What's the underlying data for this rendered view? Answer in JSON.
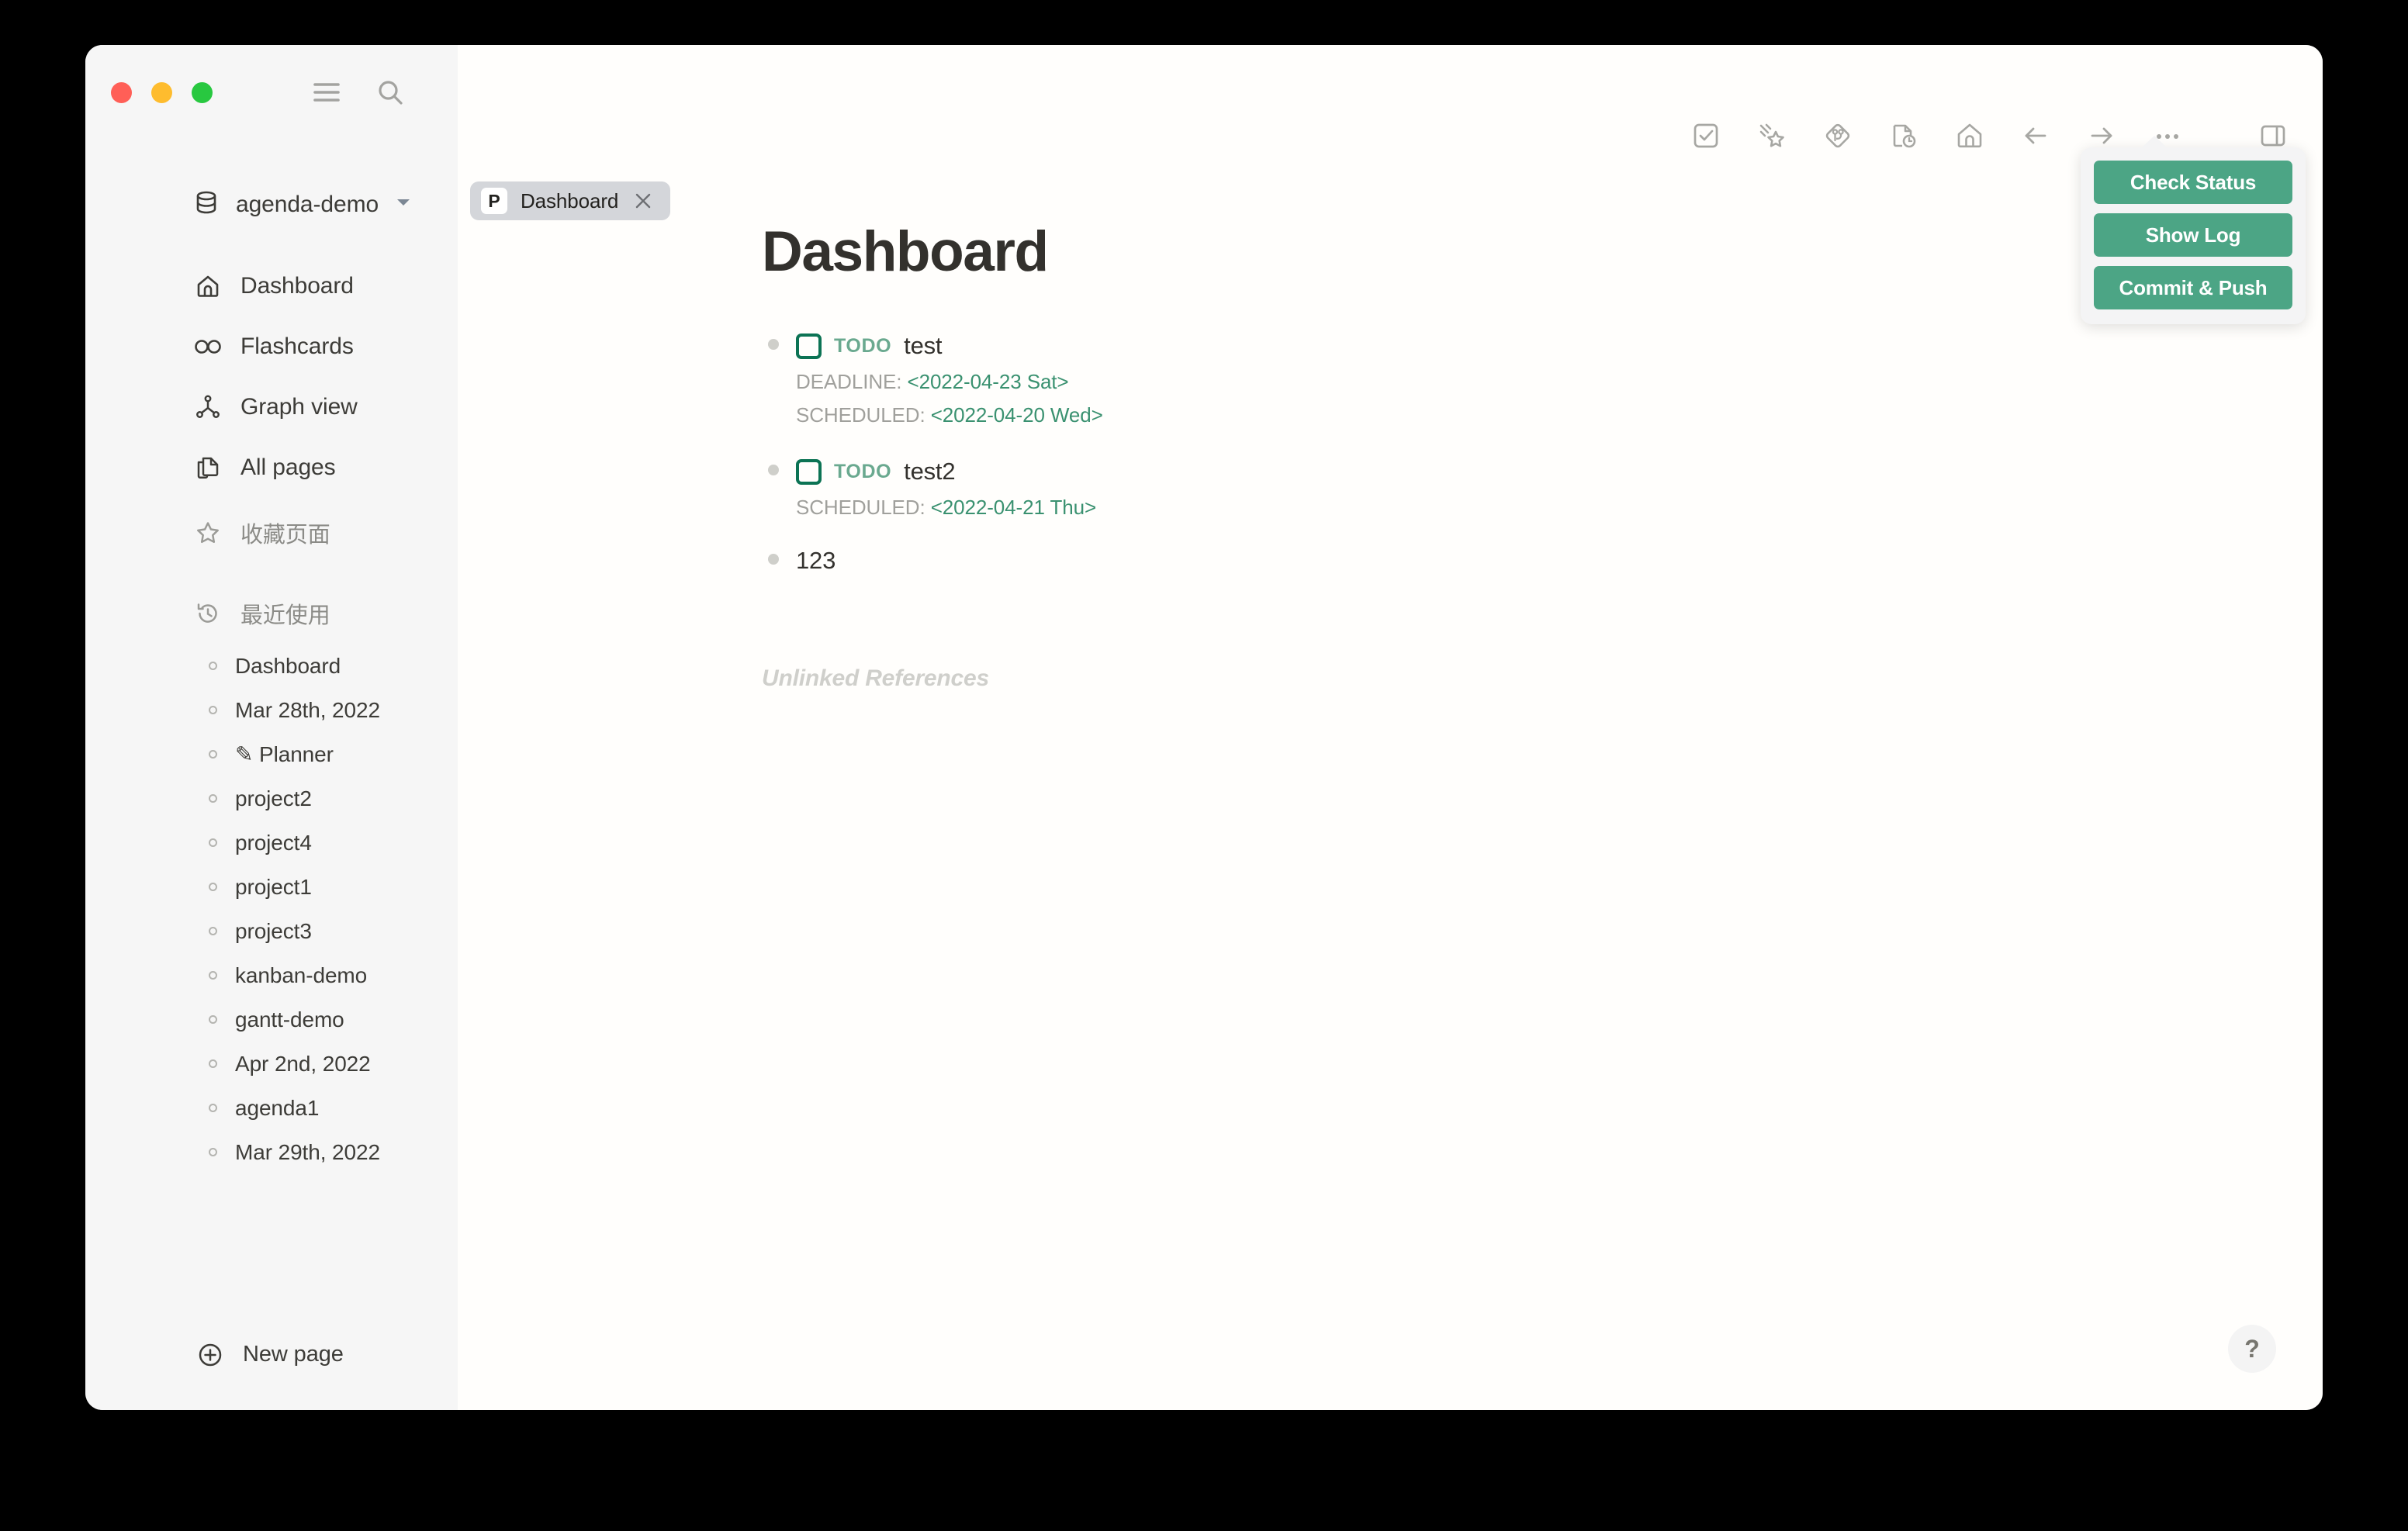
{
  "window": {
    "traffic_lights": [
      "close",
      "minimize",
      "maximize"
    ]
  },
  "sidebar": {
    "menu_icon": "hamburger-menu-icon",
    "search_icon": "search-icon",
    "repo": {
      "icon": "database-icon",
      "name": "agenda-demo",
      "chevron": "chevron-down-icon"
    },
    "nav": [
      {
        "icon": "home-icon",
        "label": "Dashboard"
      },
      {
        "icon": "infinity-icon",
        "label": "Flashcards"
      },
      {
        "icon": "graph-icon",
        "label": "Graph view"
      },
      {
        "icon": "pages-icon",
        "label": "All pages"
      }
    ],
    "favorites": {
      "icon": "star-icon",
      "label": "收藏页面"
    },
    "recent": {
      "icon": "history-clock-icon",
      "label": "最近使用"
    },
    "recent_items": [
      {
        "label": "Dashboard"
      },
      {
        "label": "Mar 28th, 2022"
      },
      {
        "label": "✎ Planner"
      },
      {
        "label": "project2"
      },
      {
        "label": "project4"
      },
      {
        "label": "project1"
      },
      {
        "label": "project3"
      },
      {
        "label": "kanban-demo"
      },
      {
        "label": "gantt-demo"
      },
      {
        "label": "Apr 2nd, 2022"
      },
      {
        "label": "agenda1"
      },
      {
        "label": "Mar 29th, 2022"
      }
    ],
    "new_page": {
      "icon": "plus-circle-icon",
      "label": "New page"
    }
  },
  "toolbar": {
    "items": [
      {
        "icon": "checkbox-task-icon",
        "name": "tasks-button"
      },
      {
        "icon": "shooting-star-icon",
        "name": "flashcards-button"
      },
      {
        "icon": "git-diamond-icon",
        "name": "git-button"
      },
      {
        "icon": "document-clock-icon",
        "name": "journal-button"
      },
      {
        "icon": "home-icon",
        "name": "home-button"
      },
      {
        "icon": "arrow-left-icon",
        "name": "back-button"
      },
      {
        "icon": "arrow-right-icon",
        "name": "forward-button"
      },
      {
        "icon": "ellipsis-icon",
        "name": "more-options-button"
      },
      {
        "icon": "right-sidebar-icon",
        "name": "toggle-right-sidebar-button"
      }
    ]
  },
  "tab": {
    "badge": "P",
    "title": "Dashboard",
    "close_icon": "close-icon"
  },
  "page": {
    "title": "Dashboard",
    "blocks": [
      {
        "type": "todo",
        "marker": "TODO",
        "text": "test",
        "meta": [
          {
            "key": "DEADLINE:",
            "value": "<2022-04-23 Sat>"
          },
          {
            "key": "SCHEDULED:",
            "value": "<2022-04-20 Wed>"
          }
        ]
      },
      {
        "type": "todo",
        "marker": "TODO",
        "text": "test2",
        "meta": [
          {
            "key": "SCHEDULED:",
            "value": "<2022-04-21 Thu>"
          }
        ]
      },
      {
        "type": "text",
        "text": "123",
        "meta": []
      }
    ],
    "unlinked_references": "Unlinked References"
  },
  "git_popup": {
    "buttons": [
      {
        "label": "Check Status"
      },
      {
        "label": "Show Log"
      },
      {
        "label": "Commit & Push"
      }
    ]
  },
  "help": {
    "label": "?"
  },
  "colors": {
    "accent_green": "#4ca585",
    "todo_border": "#0c7354",
    "todo_marker": "#6aa98f",
    "meta_value": "#3a9170",
    "sidebar_bg": "#f6f6f6",
    "main_bg": "#fffefc",
    "tab_bg": "#d4d6da",
    "popup_bg": "#f4f4f5",
    "text": "#33312d",
    "muted": "#a0a09c"
  }
}
